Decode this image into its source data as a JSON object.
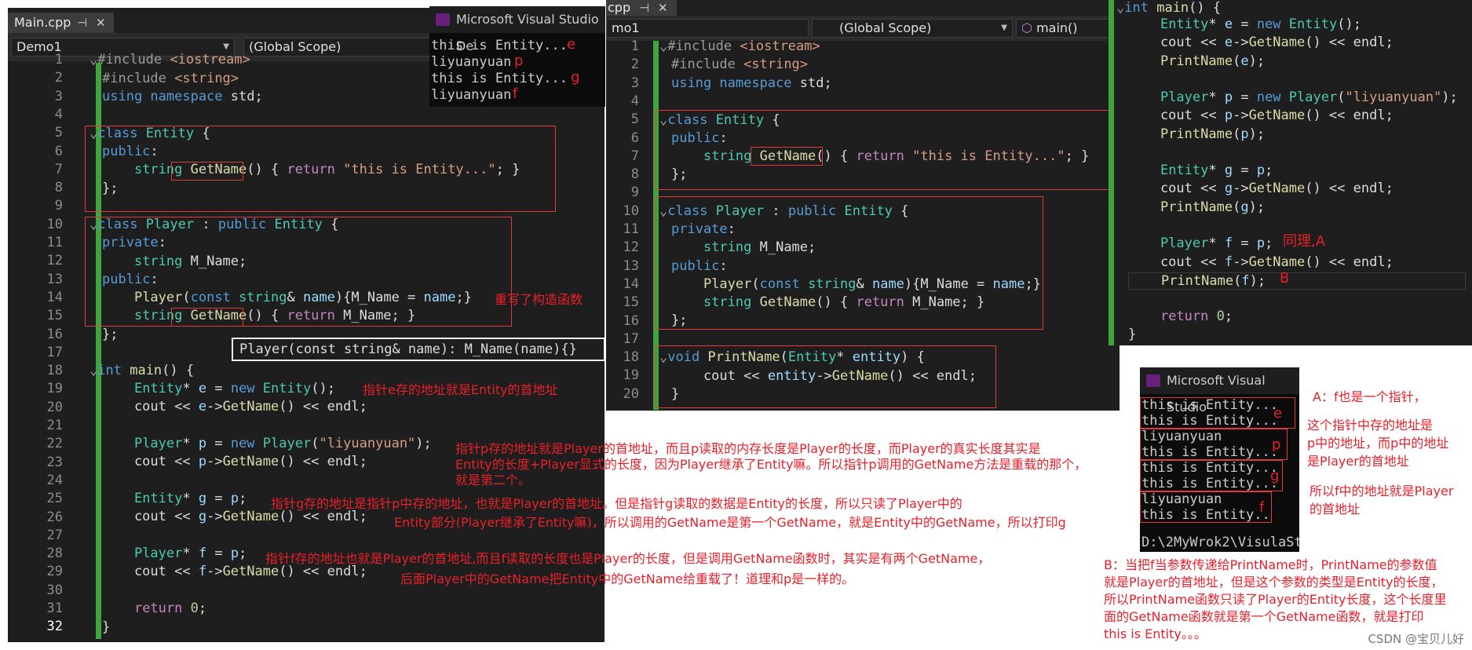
{
  "left_panel": {
    "tab": "Main.cpp",
    "project": "Demo1",
    "scope": "(Global Scope)",
    "lines": [
      "1",
      "2",
      "3",
      "4",
      "5",
      "6",
      "7",
      "8",
      "9",
      "10",
      "11",
      "12",
      "13",
      "14",
      "15",
      "16",
      "17",
      "18",
      "19",
      "20",
      "21",
      "22",
      "23",
      "24",
      "25",
      "26",
      "27",
      "28",
      "29",
      "30",
      "31",
      "32"
    ],
    "tooltip": "Player(const string& name): M_Name(name){}"
  },
  "left_console": {
    "title": "Microsoft Visual Studio De",
    "lines": [
      "this is Entity...",
      "liyuanyuan",
      "this is Entity...",
      "liyuanyuan"
    ],
    "letters": [
      "e",
      "p",
      "g",
      "f"
    ]
  },
  "mid_panel": {
    "tab": "cpp",
    "project": "mo1",
    "scope": "(Global Scope)",
    "func": "main()",
    "lines": [
      "1",
      "2",
      "3",
      "4",
      "5",
      "6",
      "7",
      "8",
      "9",
      "10",
      "11",
      "12",
      "13",
      "14",
      "15",
      "16",
      "17",
      "18",
      "19",
      "20"
    ]
  },
  "right_console": {
    "title": "Microsoft Visual Studio",
    "lines": [
      "this is Entity...",
      "this is Entity...",
      "liyuanyuan",
      "this is Entity...",
      "this is Entity...",
      "this is Entity...",
      "liyuanyuan",
      "this is Entity.."
    ],
    "letters": [
      "e",
      "p",
      "g",
      "f"
    ],
    "path": "D:\\2MyWrok2\\VisulaSt"
  },
  "annotations": {
    "rewrite_ctor": "重写了构造函数",
    "e_note": "指针e存的地址就是Entity的首地址",
    "p_note_1": "指针p存的地址就是Player的首地址，而且p读取的内存长度是Player的长度，而Player的真实长度其实是",
    "p_note_2": "Entity的长度+Player显式的长度，因为Player继承了Entity嘛。所以指针p调用的GetName方法是重载的那个，",
    "p_note_3": "就是第二个。",
    "g_note_1": "指针g存的地址是指针p中存的地址，也就是Player的首地址。但是指针g读取的数据是Entity的长度，所以只读了Player中的",
    "g_note_2": "Entity部分(Player继承了Entity嘛)，所以调用的GetName是第一个GetName，就是Entity中的GetName，所以打印g",
    "f_note_1": "指针f存的地址也就是Player的首地址,而且f读取的长度也是Player的长度，但是调用GetName函数时，其实是有两个GetName，",
    "f_note_2": "后面Player中的GetName把Entity中的GetName给重载了！道理和p是一样的。",
    "same_a": "同理,A",
    "b_mark": "B",
    "a_note_1": "A：f也是一个指针，",
    "a_note_2": "这个指针中存的地址是",
    "a_note_3": "p中的地址，而p中的地址",
    "a_note_4": "是Player的首地址",
    "a_note_5": "所以f中的地址就是Player",
    "a_note_6": "的首地址",
    "b_note_1": "B：当把f当参数传递给PrintName时，PrintName的参数值",
    "b_note_2": "就是Player的首地址，但是这个参数的类型是Entity的长度，",
    "b_note_3": "所以PrintName函数只读了Player的Entity长度，这个长度里",
    "b_note_4": "面的GetName函数就是第一个GetName函数，就是打印",
    "b_note_5": "this is Entity。。。"
  },
  "watermark": "CSDN @宝贝儿好"
}
